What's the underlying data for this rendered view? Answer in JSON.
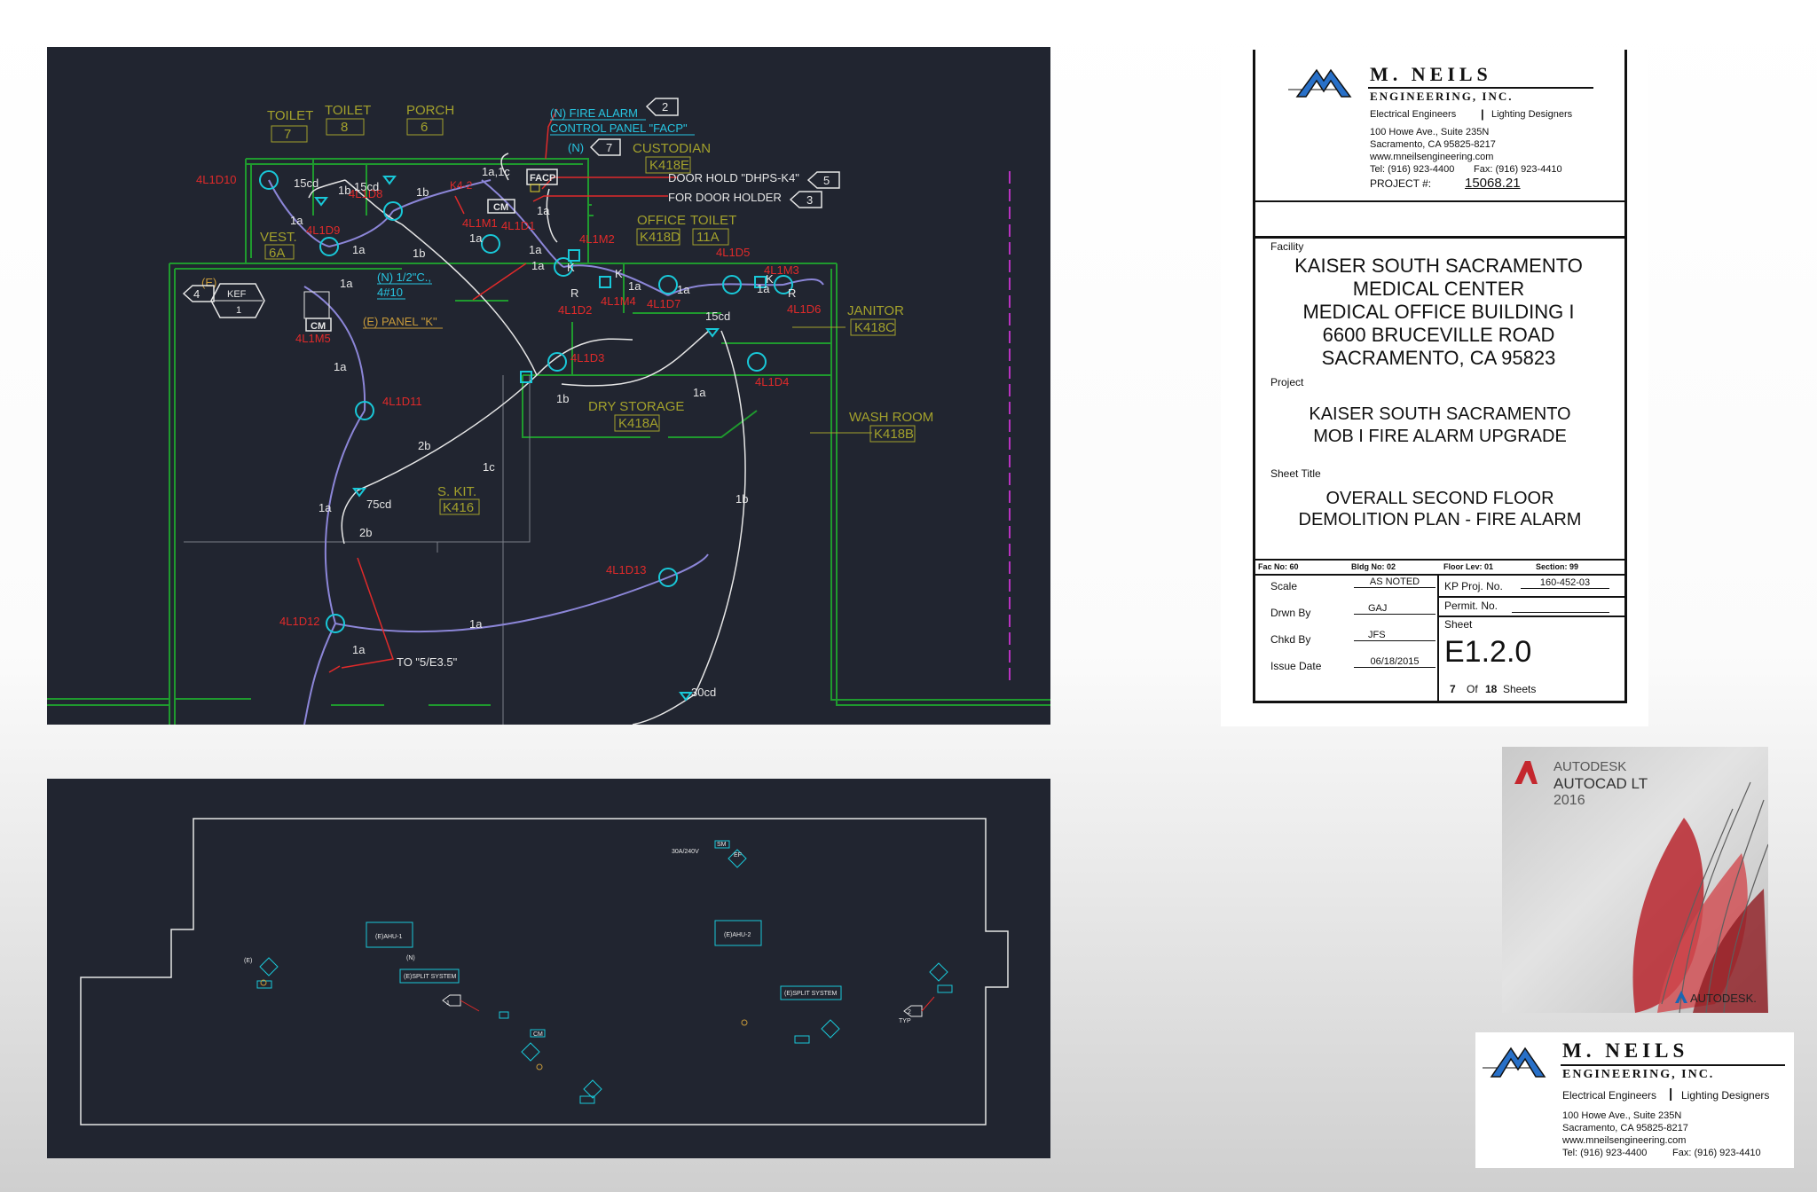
{
  "floor_plan": {
    "room_labels": [
      {
        "name": "TOILET",
        "num": "7"
      },
      {
        "name": "TOILET",
        "num": "8"
      },
      {
        "name": "PORCH",
        "num": "6"
      },
      {
        "name": "CUSTODIAN",
        "num": "K418E"
      },
      {
        "name": "OFFICE",
        "num": "K418D"
      },
      {
        "name": "TOILET",
        "num": "11A"
      },
      {
        "name": "VEST.",
        "num": "6A"
      },
      {
        "name": "JANITOR",
        "num": "K418C"
      },
      {
        "name": "WASH ROOM",
        "num": "K418B"
      },
      {
        "name": "DRY STORAGE",
        "num": "K418A"
      },
      {
        "name": "S. KIT.",
        "num": "K416"
      }
    ],
    "callouts": [
      {
        "num": "2",
        "text": "(N) FIRE ALARM"
      },
      {
        "num": "2",
        "text": "CONTROL PANEL \"FACP\""
      },
      {
        "num": "7",
        "text": "(N)"
      },
      {
        "num": "5",
        "text": "DOOR HOLD \"DHPS-K4\""
      },
      {
        "num": "3",
        "text": "FOR DOOR HOLDER"
      },
      {
        "num": "4",
        "text": "KEF 1"
      }
    ],
    "equipment": {
      "facp": "FACP",
      "cm": "CM",
      "k42": "K4-2",
      "panel_k": "(E) PANEL \"K\"",
      "conduit_1": "(N) 1/2\"C.,",
      "conduit_2": "4#10",
      "existing": "(E)",
      "to_note": "TO \"5/E3.5\""
    },
    "device_ids": [
      "4L1D10",
      "4L1D8",
      "4L1D9",
      "4L1M1",
      "4L1D1",
      "4L1M2",
      "4L1D5",
      "4L1M3",
      "4L1D2",
      "4L1M4",
      "4L1D7",
      "4L1D6",
      "4L1M5",
      "4L1D3",
      "4L1D4",
      "4L1D11",
      "4L1D13",
      "4L1D12"
    ],
    "wiring_labels": [
      "1a,1c",
      "15cd",
      "1b",
      "15cd",
      "1b",
      "1a",
      "1a",
      "1b",
      "1a",
      "1a",
      "1a",
      "1a",
      "1a",
      "15cd",
      "1a",
      "1a",
      "1a",
      "1b",
      "1a",
      "2b",
      "1c",
      "1a",
      "75cd",
      "2b",
      "1b",
      "1a",
      "1a",
      "30cd"
    ],
    "letters": [
      "K",
      "K",
      "K",
      "R",
      "R"
    ]
  },
  "roof_plan": {
    "labels": [
      "(E)AHU-1",
      "(E)AHU-2",
      "(E)SPLIT SYSTEM",
      "(E)SPLIT SYSTEM",
      "30A/240V",
      "SM",
      "EF",
      "CM",
      "(N)",
      "(E)",
      "1",
      "2",
      "TYP"
    ]
  },
  "title_block": {
    "company": "M. NEILS",
    "company_sub": "ENGINEERING, INC.",
    "disciplines_left": "Electrical Engineers",
    "disciplines_right": "Lighting Designers",
    "address1": "100 Howe Ave., Suite 235N",
    "address2": "Sacramento, CA 95825-8217",
    "website": "www.mneilsengineering.com",
    "tel": "Tel: (916) 923-4400",
    "fax": "Fax: (916) 923-4410",
    "project_no_label": "PROJECT #:",
    "project_no": "15068.21",
    "facility_label": "Facility",
    "facility_lines": [
      "KAISER SOUTH SACRAMENTO",
      "MEDICAL CENTER",
      "MEDICAL OFFICE BUILDING I",
      "6600 BRUCEVILLE ROAD",
      "SACRAMENTO, CA 95823"
    ],
    "project_label": "Project",
    "project_lines": [
      "KAISER SOUTH SACRAMENTO",
      "MOB I FIRE ALARM UPGRADE"
    ],
    "sheet_title_label": "Sheet Title",
    "sheet_title_lines": [
      "OVERALL SECOND FLOOR",
      "DEMOLITION PLAN - FIRE ALARM"
    ],
    "fac_no": "Fac No: 60",
    "bldg_no": "Bldg No: 02",
    "floor_lev": "Floor Lev: 01",
    "section": "Section: 99",
    "scale_label": "Scale",
    "scale": "AS NOTED",
    "drawn_label": "Drwn By",
    "drawn": "GAJ",
    "checked_label": "Chkd By",
    "checked": "JFS",
    "issue_label": "Issue Date",
    "issue": "06/18/2015",
    "kp_label": "KP Proj. No.",
    "kp": "160-452-03",
    "permit_label": "Permit. No.",
    "sheet_label": "Sheet",
    "sheet": "E1.2.0",
    "sheet_num": "7",
    "sheet_of": "Of",
    "sheet_total": "18",
    "sheets_word": "Sheets"
  },
  "autocad": {
    "brand": "AUTODESK",
    "product": "AUTOCAD LT",
    "year": "2016",
    "footer": "AUTODESK."
  },
  "colors": {
    "cad_bg": "#212530",
    "wall": "#1f9a2e",
    "device": "#19c8d8",
    "id_red": "#e02a2a",
    "room_label": "#a3a12c",
    "wire": "#8c86d8",
    "callout_cyan": "#27c4e0",
    "brand_blue": "#2870c8",
    "autocad_red": "#c4272e"
  }
}
